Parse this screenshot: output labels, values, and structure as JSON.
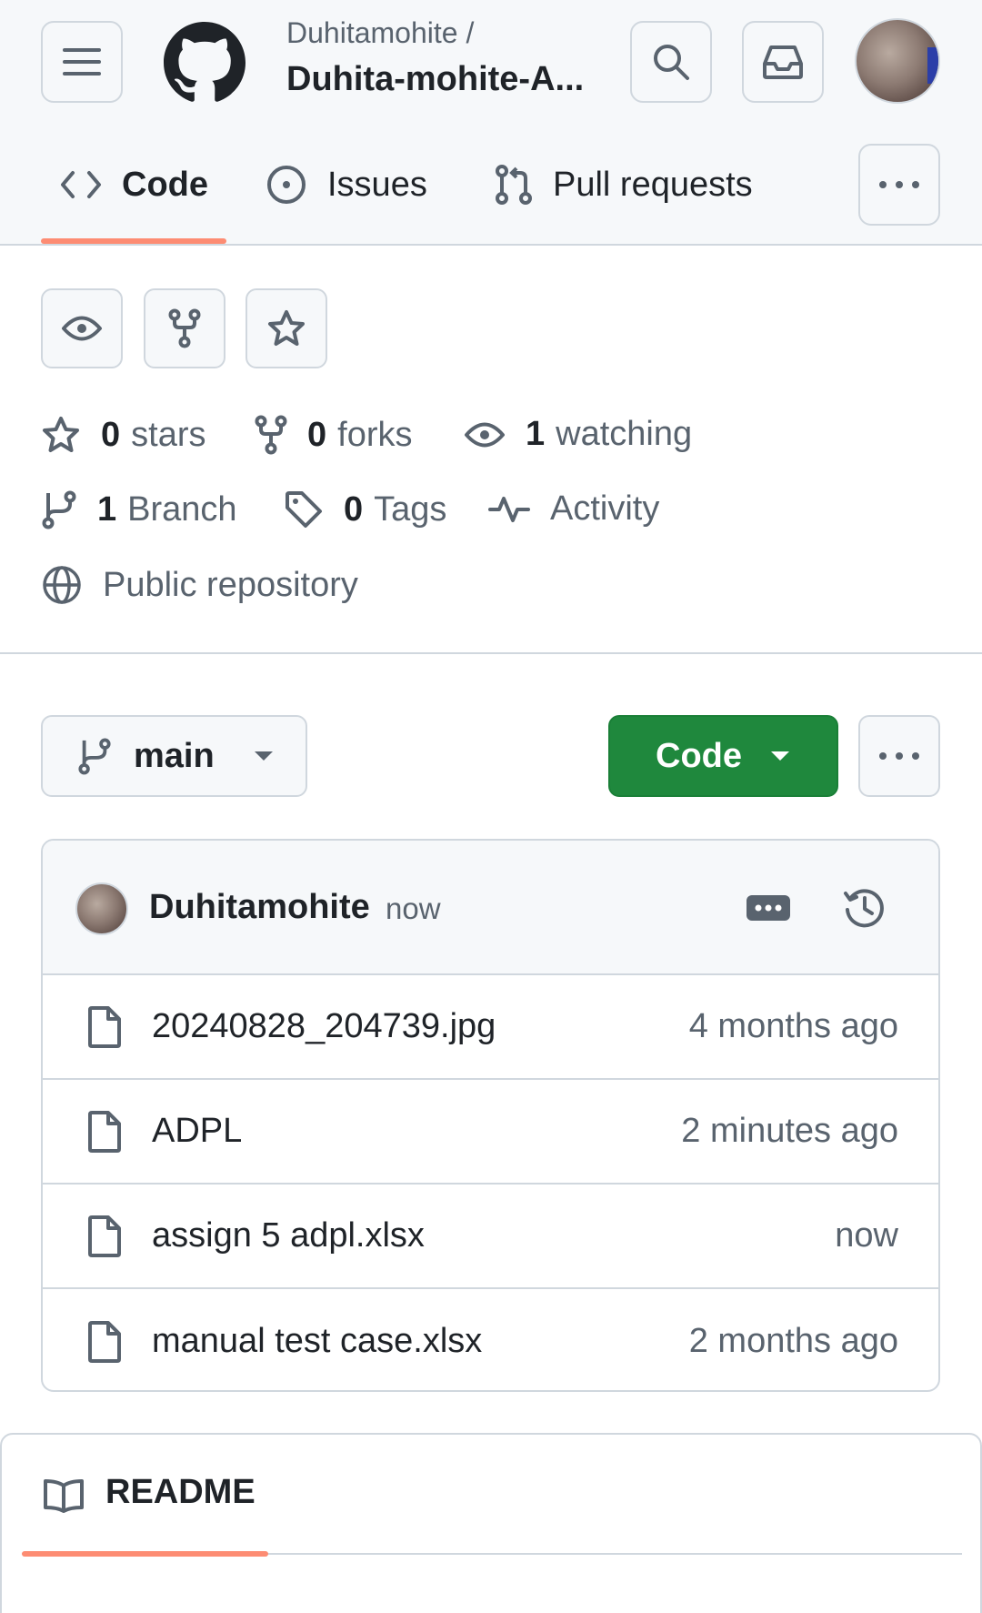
{
  "header": {
    "owner": "Duhitamohite /",
    "repo": "Duhita-mohite-A..."
  },
  "tabs": [
    {
      "label": "Code",
      "icon": "code-icon",
      "active": true
    },
    {
      "label": "Issues",
      "icon": "issue-icon"
    },
    {
      "label": "Pull requests",
      "icon": "pull-request-icon"
    }
  ],
  "stats": {
    "stars_count": "0",
    "stars_label": "stars",
    "forks_count": "0",
    "forks_label": "forks",
    "watching_count": "1",
    "watching_label": "watching",
    "branch_count": "1",
    "branch_label": "Branch",
    "tags_count": "0",
    "tags_label": "Tags",
    "activity_label": "Activity",
    "visibility_label": "Public repository"
  },
  "toolbar": {
    "branch": "main",
    "code_button": "Code"
  },
  "commit": {
    "author": "Duhitamohite",
    "time": "now"
  },
  "files": [
    {
      "name": "20240828_204739.jpg",
      "time": "4 months ago"
    },
    {
      "name": "ADPL",
      "time": "2 minutes ago"
    },
    {
      "name": "assign 5 adpl.xlsx",
      "time": "now"
    },
    {
      "name": "manual test case.xlsx",
      "time": "2 months ago"
    }
  ],
  "readme": {
    "title": "README"
  },
  "colors": {
    "accent_underline": "#fd8c73",
    "code_button_bg": "#1f883d",
    "muted_text": "#59636e",
    "border": "#d0d7de"
  }
}
